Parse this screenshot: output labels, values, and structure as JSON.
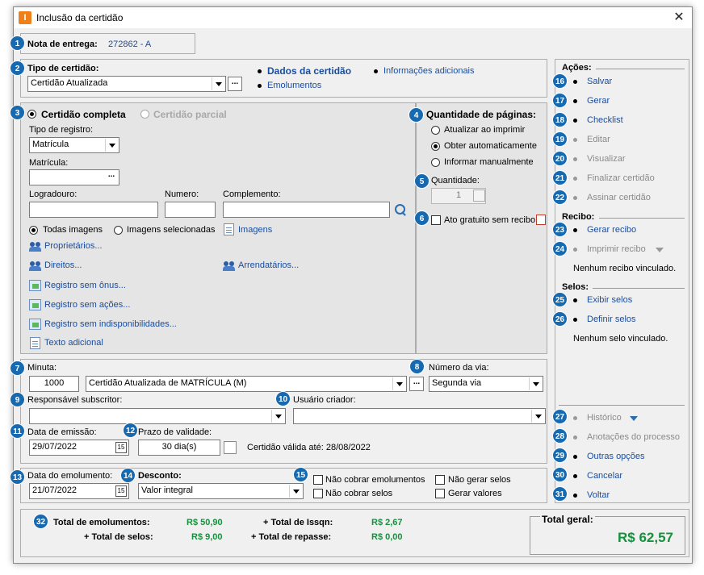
{
  "window": {
    "title": "Inclusão da certidão",
    "icon_letter": "I",
    "close": "✕"
  },
  "badges": [
    "1",
    "2",
    "3",
    "4",
    "5",
    "6",
    "7",
    "8",
    "9",
    "10",
    "11",
    "12",
    "13",
    "14",
    "15",
    "16",
    "17",
    "18",
    "19",
    "20",
    "21",
    "22",
    "23",
    "24",
    "25",
    "26",
    "27",
    "28",
    "29",
    "30",
    "31",
    "32"
  ],
  "nota": {
    "label": "Nota de entrega:",
    "value": "272862 - A"
  },
  "tipo": {
    "label": "Tipo de certidão:",
    "value": "Certidão Atualizada",
    "dots": "...",
    "nav_dados": "Dados da certidão",
    "nav_info": "Informações adicionais",
    "nav_emol": "Emolumentos"
  },
  "certidao": {
    "completa": "Certidão completa",
    "parcial": "Certidão parcial",
    "tipo_registro_label": "Tipo de registro:",
    "tipo_registro": "Matrícula",
    "matricula_label": "Matrícula:",
    "matricula": "",
    "dots": "...",
    "logradouro_label": "Logradouro:",
    "numero_label": "Numero:",
    "complemento_label": "Complemento:",
    "todas_imagens": "Todas imagens",
    "imagens_selecionadas": "Imagens selecionadas",
    "imagens": "Imagens",
    "proprietarios": "Proprietários...",
    "direitos": "Direitos...",
    "arrendatarios": "Arrendatários...",
    "onus": "Registro sem ônus...",
    "acoes": "Registro sem ações...",
    "indisp": "Registro sem indisponibilidades...",
    "texto": "Texto adicional"
  },
  "paginas": {
    "title": "Quantidade de páginas:",
    "opt1": "Atualizar ao imprimir",
    "opt2": "Obter automaticamente",
    "opt3": "Informar manualmente",
    "qtd_label": "Quantidade:",
    "qtd": "1",
    "gratuito": "Ato gratuito sem recibo"
  },
  "minuta": {
    "label": "Minuta:",
    "code": "1000",
    "text": "Certidão Atualizada de MATRÍCULA (M)",
    "dots": "...",
    "via_label": "Número da via:",
    "via": "Segunda via"
  },
  "responsavel": {
    "label": "Responsável subscritor:",
    "value": "",
    "usuario_label": "Usuário criador:",
    "usuario": ""
  },
  "emissao": {
    "label": "Data de emissão:",
    "value": "29/07/2022",
    "prazo_label": "Prazo de validade:",
    "prazo": "30 dia(s)",
    "valida": "Certidão válida até: 28/08/2022",
    "cal": "15"
  },
  "emolumento": {
    "label": "Data do emolumento:",
    "value": "21/07/2022",
    "desconto_label": "Desconto:",
    "desconto": "Valor integral",
    "cal": "15",
    "nao_cobrar_emol": "Não cobrar emolumentos",
    "nao_gerar_selos": "Não gerar selos",
    "nao_cobrar_selos": "Não cobrar selos",
    "gerar_valores": "Gerar valores"
  },
  "totais": {
    "emol_label": "Total de emolumentos:",
    "emol": "R$ 50,90",
    "selos_label": "+ Total de selos:",
    "selos": "R$ 9,00",
    "issqn_label": "+ Total de Issqn:",
    "issqn": "R$ 2,67",
    "repasse_label": "+ Total de repasse:",
    "repasse": "R$ 0,00",
    "geral_label": "Total geral:",
    "geral": "R$ 62,57"
  },
  "acoes": {
    "title": "Ações:",
    "salvar": "Salvar",
    "gerar": "Gerar",
    "checklist": "Checklist",
    "editar": "Editar",
    "visualizar": "Visualizar",
    "finalizar": "Finalizar certidão",
    "assinar": "Assinar certidão"
  },
  "recibo": {
    "title": "Recibo:",
    "gerar": "Gerar recibo",
    "imprimir": "Imprimir recibo",
    "nenhum": "Nenhum recibo vinculado."
  },
  "selos": {
    "title": "Selos:",
    "exibir": "Exibir selos",
    "definir": "Definir selos",
    "nenhum": "Nenhum selo vinculado."
  },
  "outros": {
    "historico": "Histórico",
    "anotacoes": "Anotações do processo",
    "outras": "Outras opções",
    "cancelar": "Cancelar",
    "voltar": "Voltar"
  },
  "colors": {
    "badge": "#1769b0",
    "link": "#1a4c9c",
    "green": "#16913e",
    "accent_icon": "#f07f1a"
  }
}
